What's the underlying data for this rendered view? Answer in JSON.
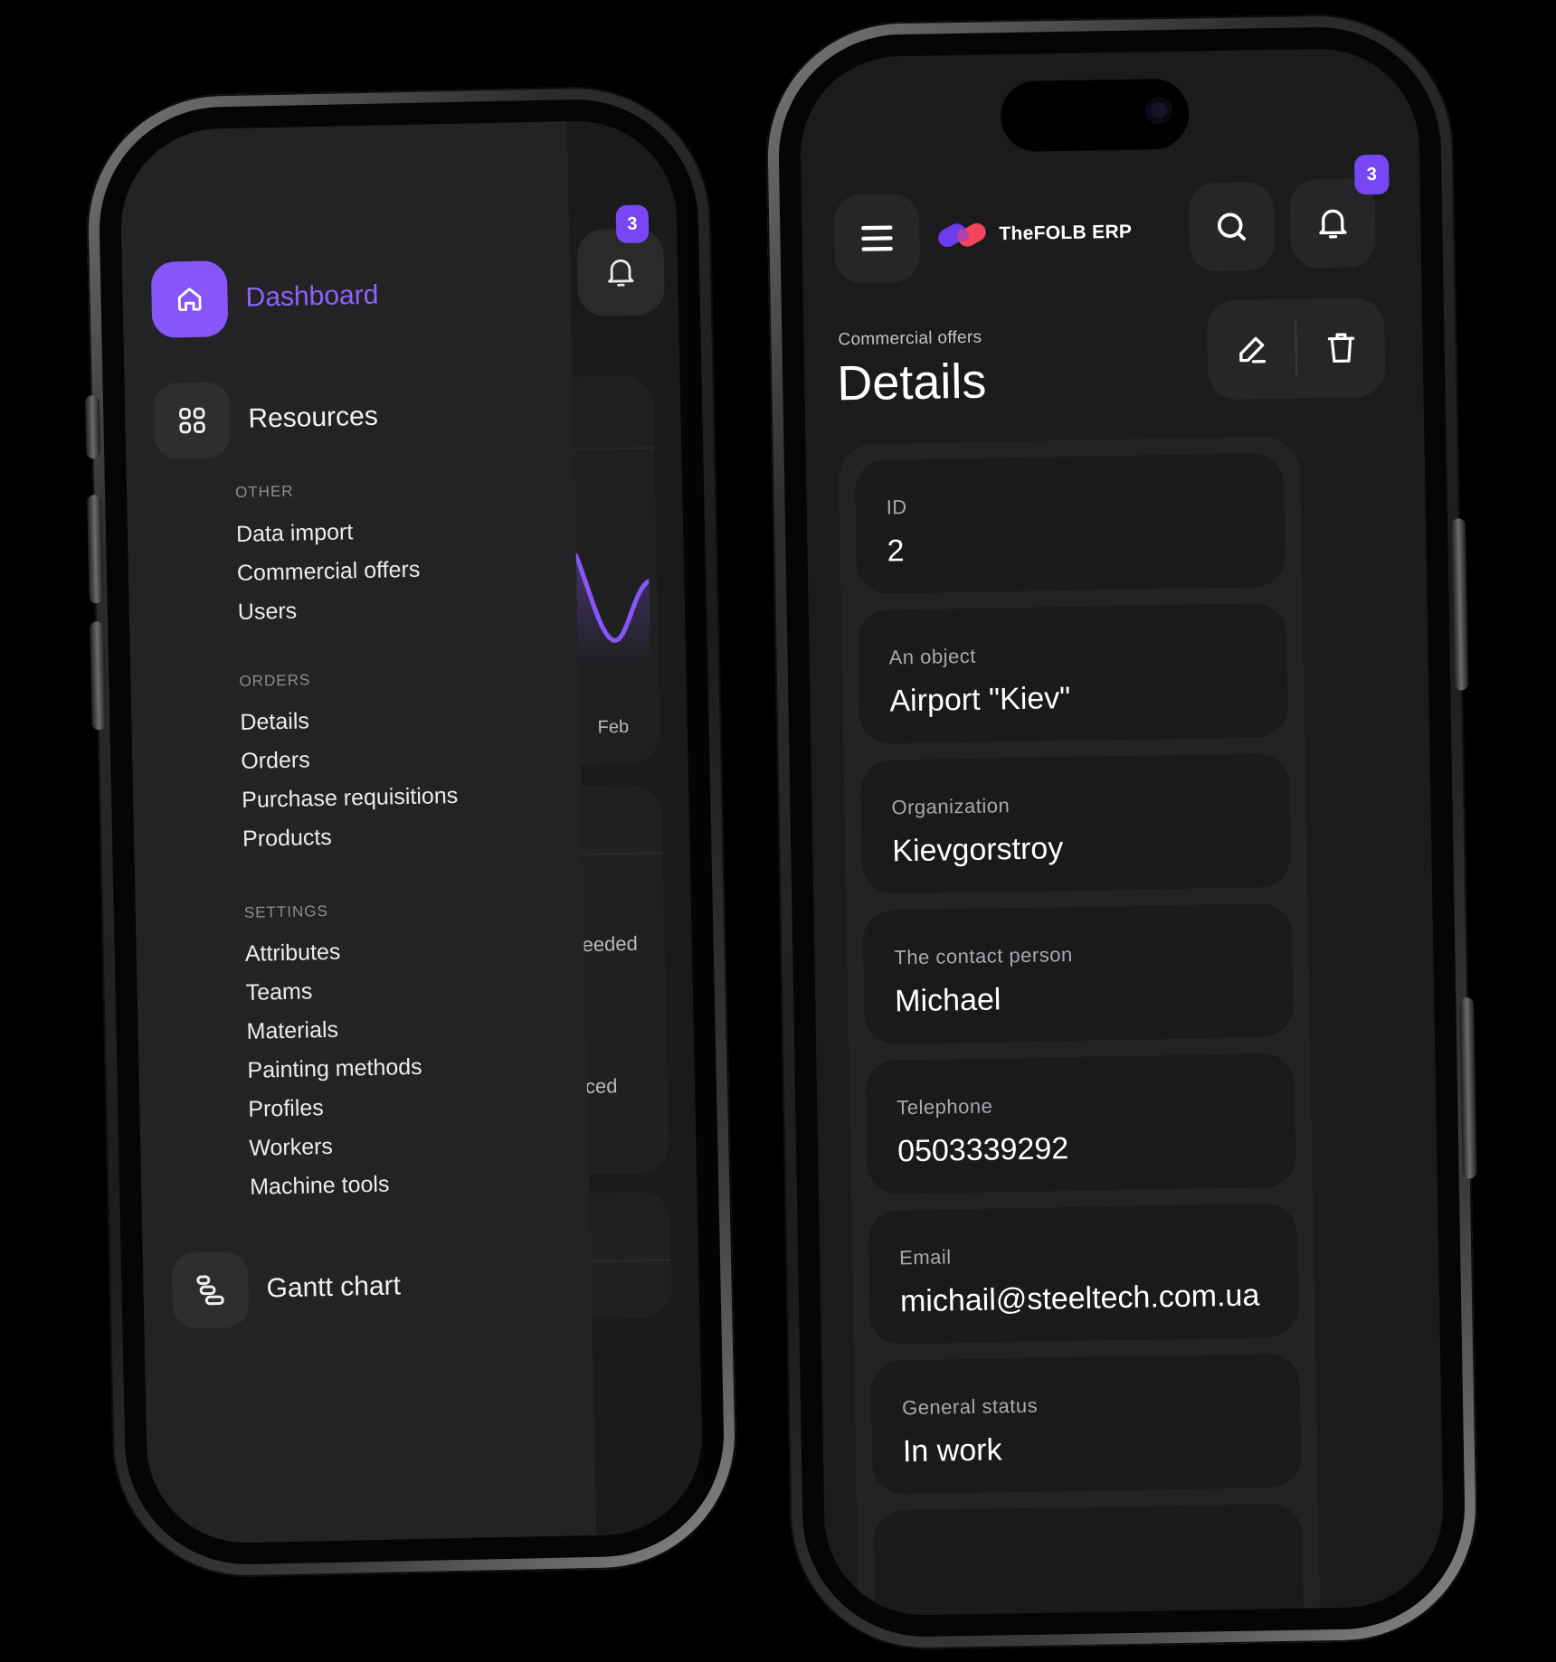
{
  "left_phone": {
    "nav": {
      "dashboard_label": "Dashboard",
      "resources_label": "Resources",
      "gantt_label": "Gantt chart"
    },
    "sections": {
      "other": {
        "title": "OTHER",
        "items": [
          "Data import",
          "Commercial offers",
          "Users"
        ]
      },
      "orders": {
        "title": "ORDERS",
        "items": [
          "Details",
          "Orders",
          "Purchase requisitions",
          "Products"
        ]
      },
      "settings": {
        "title": "SETTINGS",
        "items": [
          "Attributes",
          "Teams",
          "Materials",
          "Painting methods",
          "Profiles",
          "Workers",
          "Machine tools"
        ]
      }
    },
    "background": {
      "notification_count": "3",
      "chart_month": "Feb",
      "partial_text_1": "eeded",
      "partial_text_2": "ced"
    }
  },
  "right_phone": {
    "header": {
      "app_name": "TheFOLB ERP",
      "notification_count": "3"
    },
    "breadcrumb": "Commercial offers",
    "title": "Details",
    "fields": [
      {
        "label": "ID",
        "value": "2"
      },
      {
        "label": "An object",
        "value": "Airport \"Kiev\""
      },
      {
        "label": "Organization",
        "value": "Kievgorstroy"
      },
      {
        "label": "The contact person",
        "value": "Michael"
      },
      {
        "label": "Telephone",
        "value": "0503339292"
      },
      {
        "label": "Email",
        "value": "michail@steeltech.com.ua"
      },
      {
        "label": "General status",
        "value": "In work"
      }
    ]
  },
  "colors": {
    "accent": "#8756f8",
    "accent_text": "#8d63ff",
    "badge": "#7747f5",
    "logo_left": "#6a3df0",
    "logo_right": "#f0455a",
    "screen_bg": "#1c1c1e",
    "card_bg": "#1a1a1c"
  },
  "icons": [
    "home-icon",
    "grid-icon",
    "gantt-icon",
    "bell-icon",
    "menu-icon",
    "search-icon",
    "edit-icon",
    "trash-icon"
  ]
}
